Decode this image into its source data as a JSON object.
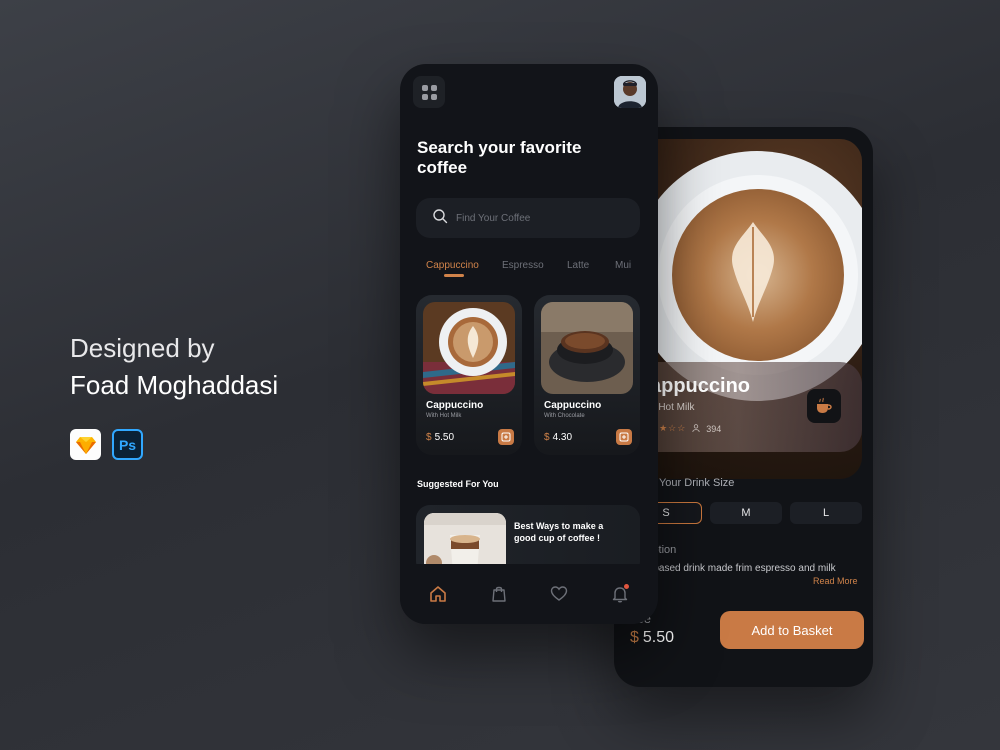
{
  "credit": {
    "line1": "Designed by",
    "line2": "Foad Moghaddasi"
  },
  "tools": [
    {
      "name": "Sketch",
      "icon": "sketch-icon"
    },
    {
      "name": "Ps",
      "icon": "photoshop-icon"
    }
  ],
  "home": {
    "title": "Search your favorite coffee",
    "search": {
      "placeholder": "Find Your Coffee",
      "value": ""
    },
    "tabs": [
      {
        "label": "Cappuccino",
        "active": true
      },
      {
        "label": "Espresso",
        "active": false
      },
      {
        "label": "Latte",
        "active": false
      },
      {
        "label": "Mui",
        "active": false
      }
    ],
    "cards": [
      {
        "name": "Cappuccino",
        "subtitle": "With Hot Milk",
        "currency": "$",
        "price": "5.50"
      },
      {
        "name": "Cappuccino",
        "subtitle": "With Chocolate",
        "currency": "$",
        "price": "4.30"
      }
    ],
    "suggested": {
      "title": "Suggested For You",
      "card_text": "Best Ways to make a good cup of coffee !"
    },
    "nav": [
      "home-icon",
      "bag-icon",
      "heart-icon",
      "bell-icon"
    ]
  },
  "detail": {
    "name": "appuccino",
    "subtitle": "h Hot Milk",
    "rating_stars": "★★☆☆",
    "reviews": "394",
    "size_title": "e Your Drink Size",
    "sizes": [
      {
        "label": "S",
        "selected": true
      },
      {
        "label": "M",
        "selected": false
      },
      {
        "label": "L",
        "selected": false
      }
    ],
    "description_title": "iption",
    "description": "-based drink made frim espresso and milk",
    "read_more": "Read More",
    "price_label": "rice",
    "price_currency": "$",
    "price": "5.50",
    "basket_button": "Add to Basket"
  },
  "colors": {
    "accent": "#c97a45",
    "background": "#121419",
    "text_muted": "#9a9ca2"
  }
}
